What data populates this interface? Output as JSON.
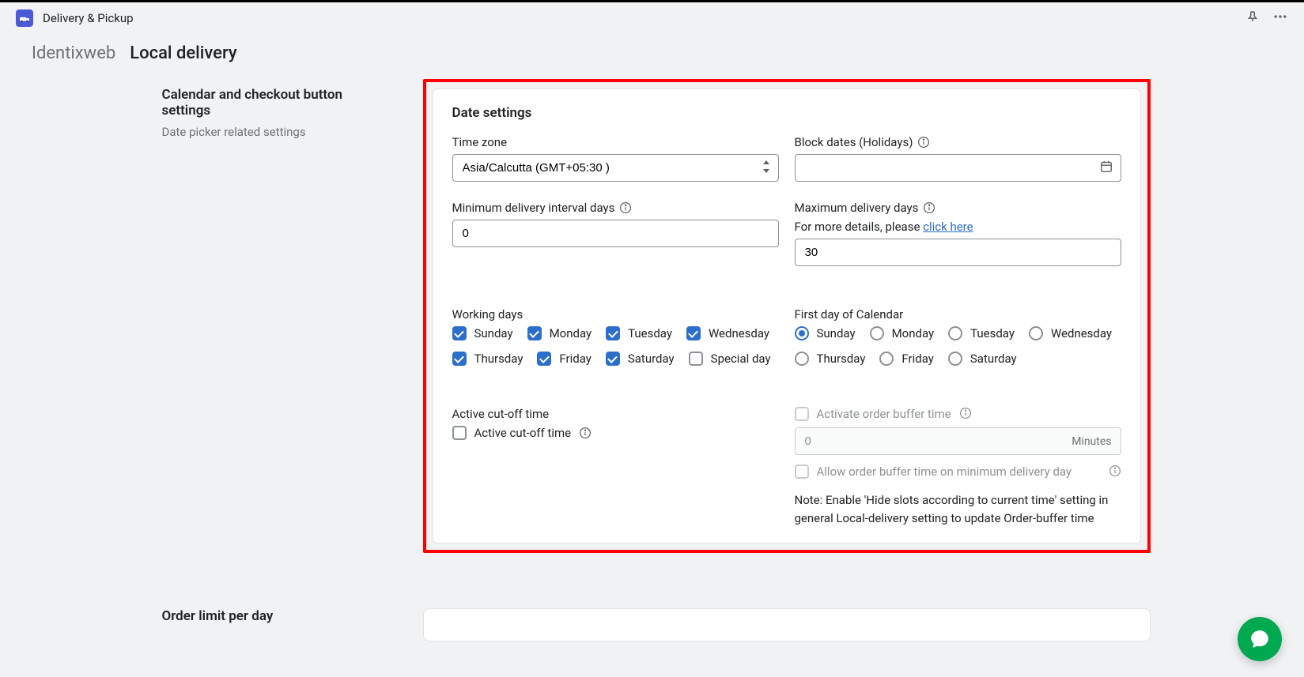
{
  "header": {
    "app_title": "Delivery & Pickup"
  },
  "breadcrumb": {
    "item1": "Identixweb",
    "item2": "Local delivery"
  },
  "sidebar": {
    "calendar": {
      "title": "Calendar and checkout button settings",
      "desc": "Date picker related settings"
    },
    "order_limit": {
      "title": "Order limit per day"
    }
  },
  "card": {
    "title": "Date settings",
    "timezone": {
      "label": "Time zone",
      "value": "Asia/Calcutta   (GMT+05:30 )"
    },
    "block_dates": {
      "label": "Block dates (Holidays)",
      "value": ""
    },
    "min_interval": {
      "label": "Minimum delivery interval days",
      "value": "0"
    },
    "max_days": {
      "label": "Maximum delivery days",
      "help_prefix": "For more details, please ",
      "help_link": "click here",
      "value": "30"
    },
    "working_days": {
      "label": "Working days",
      "days": [
        "Sunday",
        "Monday",
        "Tuesday",
        "Wednesday",
        "Thursday",
        "Friday",
        "Saturday",
        "Special day"
      ],
      "checked": [
        true,
        true,
        true,
        true,
        true,
        true,
        true,
        false
      ]
    },
    "first_day": {
      "label": "First day of Calendar",
      "days": [
        "Sunday",
        "Monday",
        "Tuesday",
        "Wednesday",
        "Thursday",
        "Friday",
        "Saturday"
      ],
      "selected": 0
    },
    "cutoff": {
      "label": "Active cut-off time",
      "checkbox_label": "Active cut-off time"
    },
    "buffer": {
      "activate_label": "Activate order buffer time",
      "value": "0",
      "suffix": "Minutes",
      "allow_label": "Allow order buffer time on minimum delivery day",
      "note": "Note: Enable 'Hide slots according to current time' setting in general Local-delivery setting to update Order-buffer time"
    }
  }
}
